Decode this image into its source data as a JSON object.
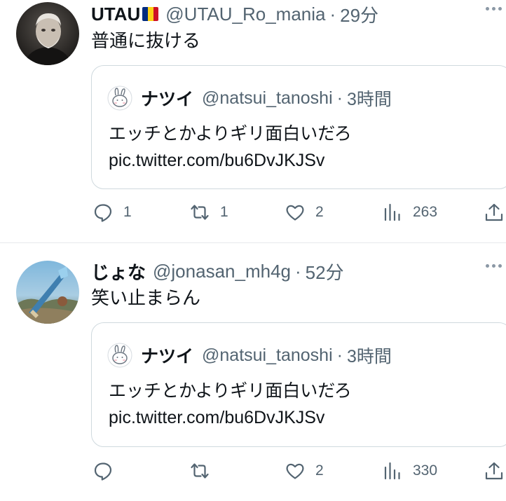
{
  "tweets": [
    {
      "name": "UTAU",
      "handle": "@UTAU_Ro_mania",
      "separator": "·",
      "time": "29分",
      "text": "普通に抜ける",
      "quote": {
        "name": "ナツイ",
        "handle": "@natsui_tanoshi",
        "separator": "·",
        "time": "3時間",
        "line1": "エッチとかよりギリ面白いだろ",
        "line2": "pic.twitter.com/bu6DvJKJSv"
      },
      "actions": {
        "replies": "1",
        "retweets": "1",
        "likes": "2",
        "views": "263"
      }
    },
    {
      "name": "じょな",
      "handle": "@jonasan_mh4g",
      "separator": "·",
      "time": "52分",
      "text": "笑い止まらん",
      "quote": {
        "name": "ナツイ",
        "handle": "@natsui_tanoshi",
        "separator": "·",
        "time": "3時間",
        "line1": "エッチとかよりギリ面白いだろ",
        "line2": "pic.twitter.com/bu6DvJKJSv"
      },
      "actions": {
        "replies": "",
        "retweets": "",
        "likes": "2",
        "views": "330"
      }
    }
  ],
  "icons": [
    "more-icon",
    "reply-icon",
    "retweet-icon",
    "like-icon",
    "views-icon",
    "share-icon",
    "romania-flag-icon"
  ],
  "colors": {
    "text": "#0f1419",
    "secondary": "#536471",
    "border": "#cfd9de",
    "flag": [
      "#002b7f",
      "#fcd116",
      "#ce1126"
    ]
  }
}
